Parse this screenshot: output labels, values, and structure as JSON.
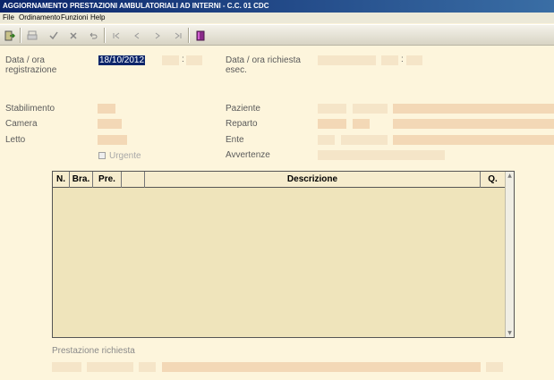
{
  "window": {
    "title": "AGGIORNAMENTO PRESTAZIONI AMBULATORIALI AD INTERNI - C.C.  01 CDC"
  },
  "menu": {
    "items": [
      "File",
      "Ordinamento",
      "Funzioni",
      "Help"
    ]
  },
  "toolbar": {
    "buttons": [
      "exit-icon",
      "print-icon",
      "check-icon",
      "cancel-icon",
      "undo-icon",
      "first-record-icon",
      "previous-record-icon",
      "next-record-icon",
      "last-record-icon",
      "book-icon"
    ]
  },
  "form": {
    "data_registrazione_label": "Data / ora registrazione",
    "data_registrazione_value": "18/10/2012",
    "data_richiesta_label": "Data / ora richiesta esec.",
    "time_separator": ":",
    "stabilimento_label": "Stabilimento",
    "camera_label": "Camera",
    "letto_label": "Letto",
    "paziente_label": "Paziente",
    "reparto_label": "Reparto",
    "ente_label": "Ente",
    "avvertenze_label": "Avvertenze",
    "urgente_label": "Urgente",
    "urgente_checked": false,
    "prestazione_label": "Prestazione richiesta"
  },
  "grid": {
    "columns": [
      "N.",
      "Bra.",
      "Pre.",
      "",
      "Descrizione",
      "Q."
    ],
    "rows": []
  }
}
